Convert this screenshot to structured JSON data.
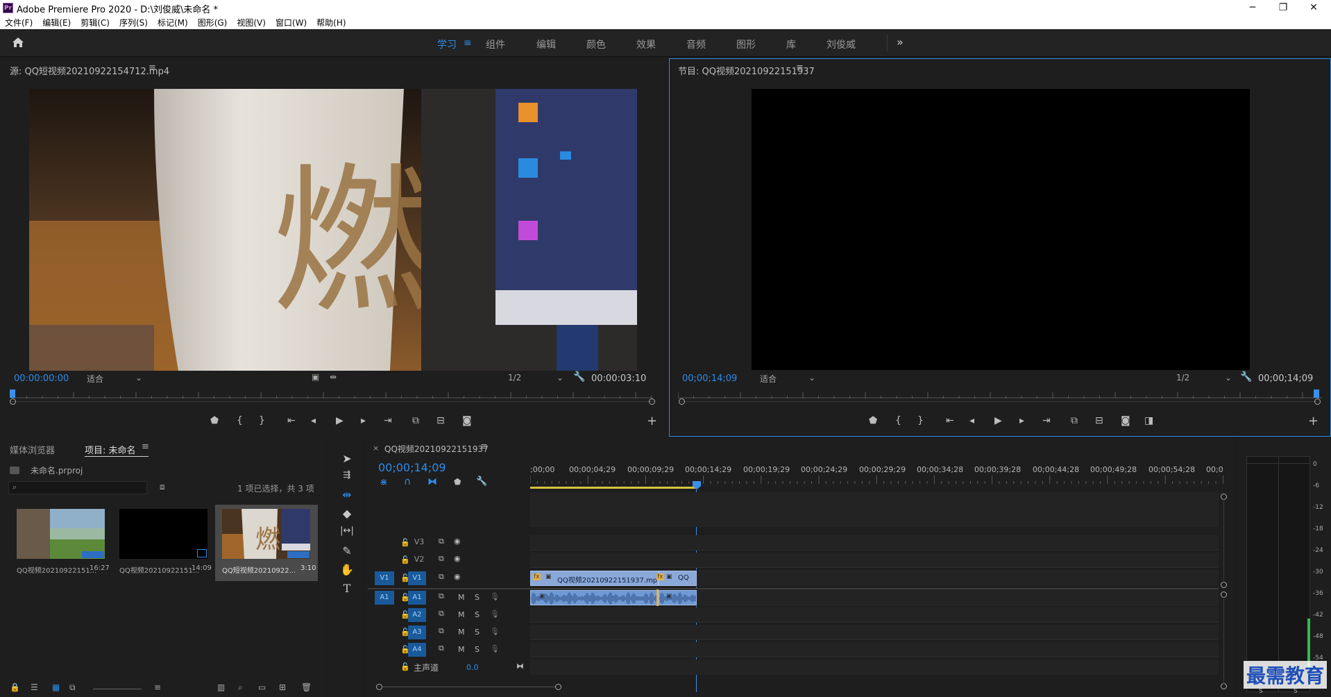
{
  "app": {
    "title": "Adobe Premiere Pro 2020 - D:\\刘俊威\\未命名 *",
    "logo": "Pr",
    "window_controls": [
      "─",
      "❐",
      "✕"
    ]
  },
  "menu": [
    "文件(F)",
    "编辑(E)",
    "剪辑(C)",
    "序列(S)",
    "标记(M)",
    "图形(G)",
    "视图(V)",
    "窗口(W)",
    "帮助(H)"
  ],
  "workspaces": {
    "active": "学习",
    "items": [
      "学习",
      "组件",
      "编辑",
      "颜色",
      "效果",
      "音频",
      "图形",
      "库",
      "刘俊威"
    ],
    "more": "»"
  },
  "source_monitor": {
    "title": "源: QQ短视频20210922154712.mp4",
    "timecode": "00:00:00:00",
    "fit": "适合",
    "resolution": "1/2",
    "duration": "00:00:03:10"
  },
  "program_monitor": {
    "title": "节目: QQ视频20210922151937",
    "timecode": "00;00;14;09",
    "fit": "适合",
    "resolution": "1/2",
    "duration": "00;00;14;09"
  },
  "project_panel": {
    "tabs": [
      "媒体浏览器",
      "项目: 未命名"
    ],
    "active_tab": "项目: 未命名",
    "project_file": "未命名.prproj",
    "search_placeholder": "",
    "selection_status": "1 项已选择，共 3 项",
    "items": [
      {
        "name": "QQ视频20210922151...",
        "duration": "16:27"
      },
      {
        "name": "QQ视频20210922151...",
        "duration": "14:09"
      },
      {
        "name": "QQ短视频20210922...",
        "duration": "3:10"
      }
    ]
  },
  "timeline": {
    "tab_title": "QQ视频20210922151937",
    "timecode": "00;00;14;09",
    "ruler_labels": [
      ";00;00",
      "00;00;04;29",
      "00;00;09;29",
      "00;00;14;29",
      "00;00;19;29",
      "00;00;24;29",
      "00;00;29;29",
      "00;00;34;28",
      "00;00;39;28",
      "00;00;44;28",
      "00;00;49;28",
      "00;00;54;28",
      "00;0"
    ],
    "video_tracks": [
      {
        "label": "V3",
        "source": ""
      },
      {
        "label": "V2",
        "source": ""
      },
      {
        "label": "V1",
        "source": "V1"
      }
    ],
    "audio_tracks": [
      {
        "label": "A1",
        "source": "A1",
        "m": "M",
        "s": "S"
      },
      {
        "label": "A2",
        "source": "",
        "m": "M",
        "s": "S"
      },
      {
        "label": "A3",
        "source": "",
        "m": "M",
        "s": "S"
      },
      {
        "label": "A4",
        "source": "",
        "m": "M",
        "s": "S"
      }
    ],
    "master": {
      "label": "主声道",
      "value": "0.0"
    },
    "clips": {
      "video1_name": "QQ视频20210922151937.mp",
      "video2_name": "QQ"
    }
  },
  "audio_meter": {
    "labels": [
      "0",
      "-6",
      "-12",
      "-18",
      "-24",
      "-30",
      "-36",
      "-42",
      "-48",
      "-54"
    ],
    "solo": [
      "S",
      "S"
    ]
  },
  "watermark": "最需教育",
  "colors": {
    "accent": "#2d8ceb",
    "clip_video": "#8aa8d8",
    "clip_audio": "#6f9ad6",
    "playhead": "#3a8fe8",
    "work_area": "#d6c33a"
  }
}
